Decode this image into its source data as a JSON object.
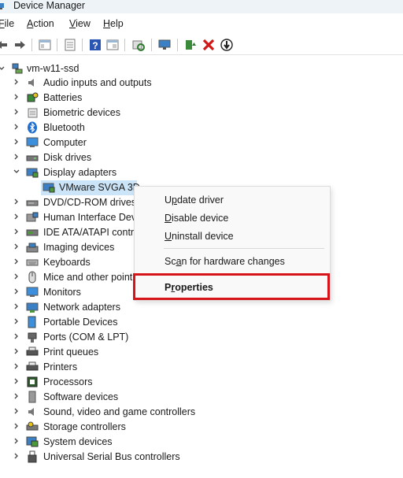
{
  "window": {
    "title": "Device Manager",
    "icon": "device-manager-icon"
  },
  "menu": [
    {
      "pre": "",
      "u": "F",
      "post": "ile"
    },
    {
      "pre": "",
      "u": "A",
      "post": "ction"
    },
    {
      "pre": "",
      "u": "V",
      "post": "iew"
    },
    {
      "pre": "",
      "u": "H",
      "post": "elp"
    }
  ],
  "toolbar": [
    "back-arrow-icon",
    "forward-arrow-icon",
    "show-hide-tree-icon",
    "properties-icon",
    "help-icon",
    "view-icon",
    "scan-hardware-icon",
    "monitor-icon",
    "update-driver-icon",
    "uninstall-icon",
    "disable-device-icon"
  ],
  "tree": {
    "root": "vm-w11-ssd",
    "categories": [
      "Audio inputs and outputs",
      "Batteries",
      "Biometric devices",
      "Bluetooth",
      "Computer",
      "Disk drives",
      "Display adapters",
      "VMware SVGA 3D",
      "DVD/CD-ROM drives",
      "Human Interface Dev",
      "IDE ATA/ATAPI contro",
      "Imaging devices",
      "Keyboards",
      "Mice and other point",
      "Monitors",
      "Network adapters",
      "Portable Devices",
      "Ports (COM & LPT)",
      "Print queues",
      "Printers",
      "Processors",
      "Software devices",
      "Sound, video and game controllers",
      "Storage controllers",
      "System devices",
      "Universal Serial Bus controllers"
    ]
  },
  "context_menu": {
    "update_driver": {
      "pre": "U",
      "u": "p",
      "post": "date driver"
    },
    "disable_device": {
      "pre": "",
      "u": "D",
      "post": "isable device"
    },
    "uninstall_device": {
      "pre": "",
      "u": "U",
      "post": "ninstall device"
    },
    "scan_hardware": {
      "pre": "Sc",
      "u": "a",
      "post": "n for hardware changes"
    },
    "properties": {
      "pre": "P",
      "u": "r",
      "post": "operties"
    }
  },
  "colors": {
    "highlight_box": "#d7141a",
    "selection": "#cce4f7"
  }
}
